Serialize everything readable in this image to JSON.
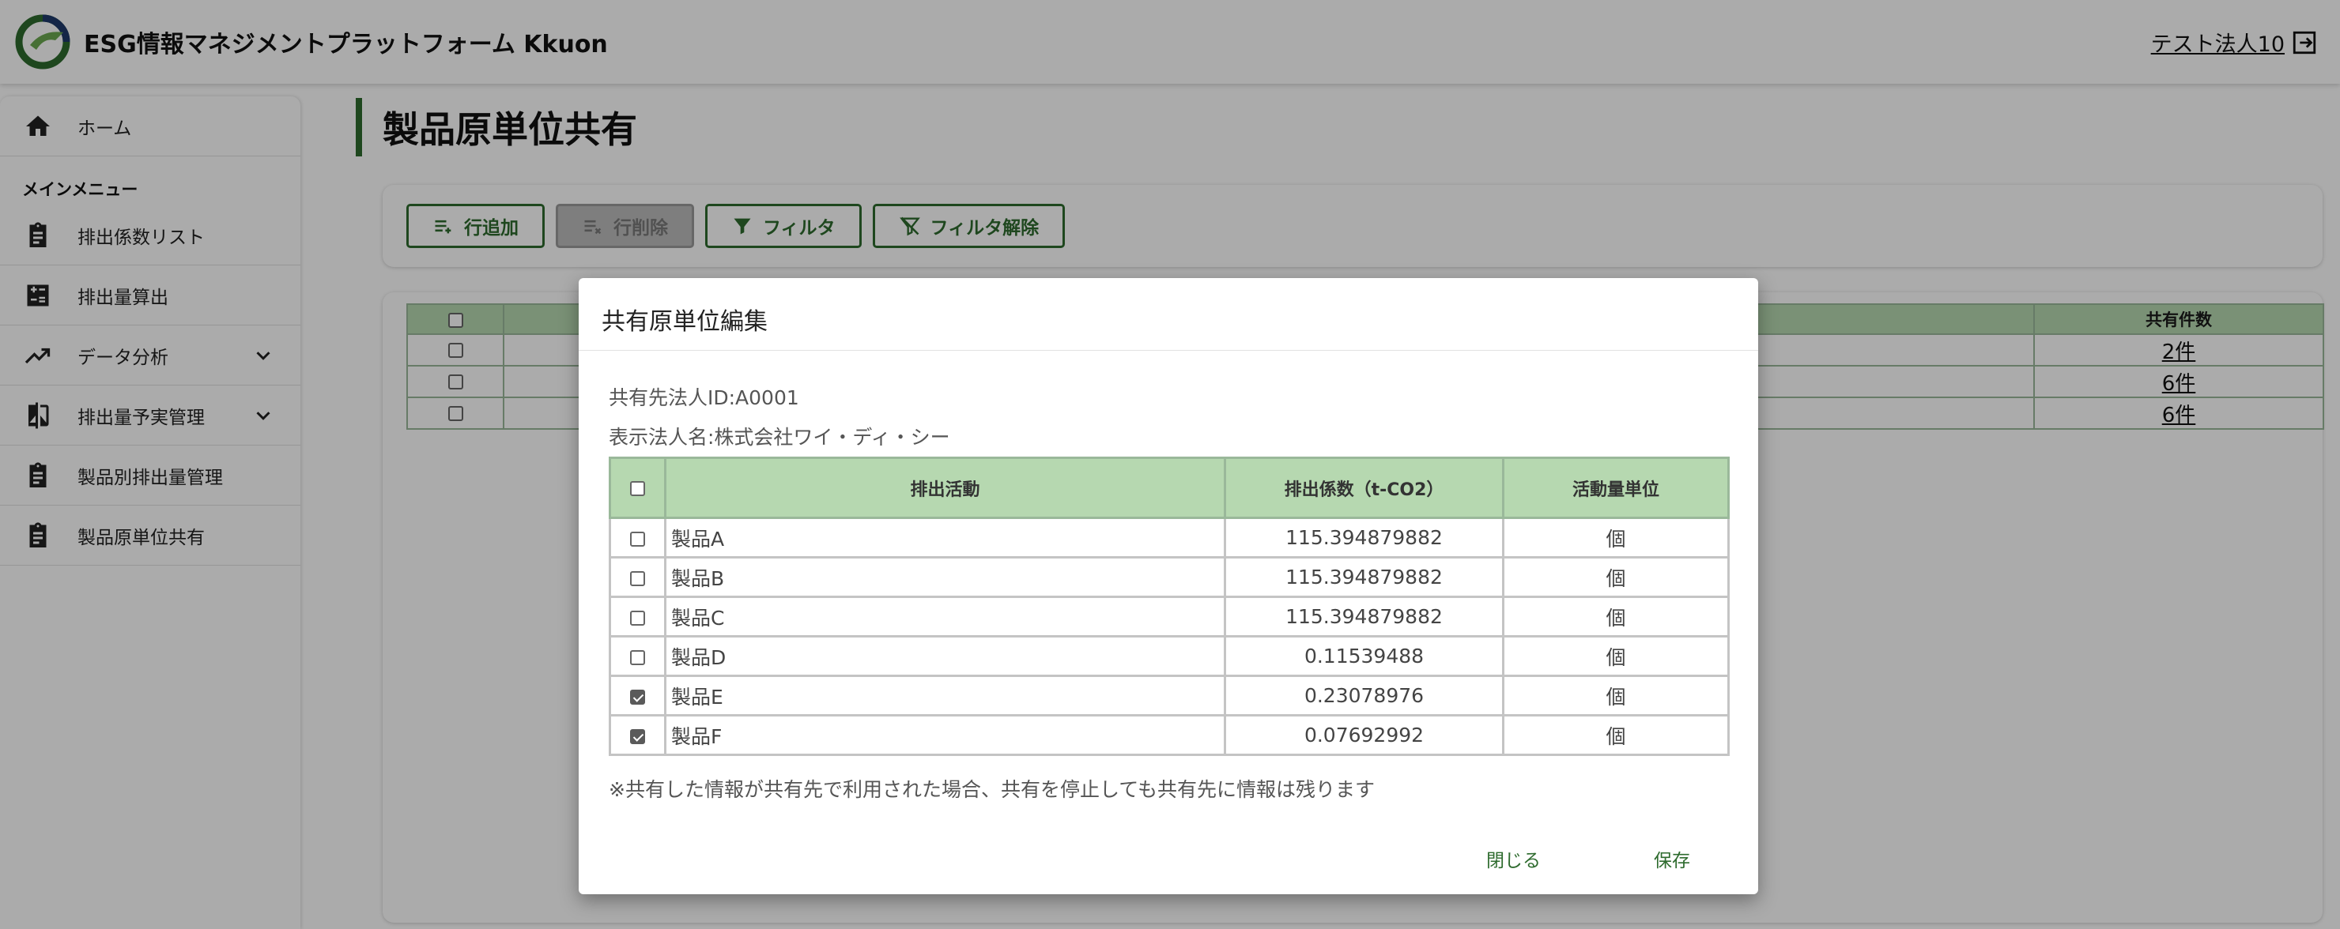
{
  "header": {
    "app_title": "ESG情報マネジメントプラットフォーム Kkuon",
    "user_name": "テスト法人10"
  },
  "sidebar": {
    "home_label": "ホーム",
    "menu_header": "メインメニュー",
    "items": [
      {
        "label": "排出係数リスト",
        "icon": "clipboard-icon"
      },
      {
        "label": "排出量算出",
        "icon": "calculator-icon"
      },
      {
        "label": "データ分析",
        "icon": "trending-up-icon"
      },
      {
        "label": "排出量予実管理",
        "icon": "compare-icon"
      },
      {
        "label": "製品別排出量管理",
        "icon": "clipboard-icon"
      },
      {
        "label": "製品原単位共有",
        "icon": "clipboard-icon"
      }
    ]
  },
  "page": {
    "title": "製品原単位共有",
    "toolbar": {
      "add_row": "行追加",
      "delete_row": "行削除",
      "filter": "フィルタ",
      "clear_filter": "フィルタ解除"
    },
    "table": {
      "count_header": "共有件数",
      "rows": [
        {
          "count": "2件"
        },
        {
          "count": "6件"
        },
        {
          "count": "6件"
        }
      ]
    }
  },
  "dialog": {
    "title": "共有原単位編集",
    "partner_id": "共有先法人ID:A0001",
    "partner_name": "表示法人名:株式会社ワイ・ディ・シー",
    "columns": {
      "activity": "排出活動",
      "factor": "排出係数（t-CO2）",
      "unit": "活動量単位"
    },
    "rows": [
      {
        "activity": "製品A",
        "factor": "115.394879882",
        "unit": "個",
        "checked": false
      },
      {
        "activity": "製品B",
        "factor": "115.394879882",
        "unit": "個",
        "checked": false
      },
      {
        "activity": "製品C",
        "factor": "115.394879882",
        "unit": "個",
        "checked": false
      },
      {
        "activity": "製品D",
        "factor": "0.11539488",
        "unit": "個",
        "checked": false
      },
      {
        "activity": "製品E",
        "factor": "0.23078976",
        "unit": "個",
        "checked": true
      },
      {
        "activity": "製品F",
        "factor": "0.07692992",
        "unit": "個",
        "checked": true
      }
    ],
    "note": "※共有した情報が共有先で利用された場合、共有を停止しても共有先に情報は残ります",
    "close_label": "閉じる",
    "save_label": "保存"
  },
  "colors": {
    "accent": "#2e6b2e",
    "table_header": "#b6d8b0",
    "overlay": "rgba(0,0,0,0.33)"
  }
}
